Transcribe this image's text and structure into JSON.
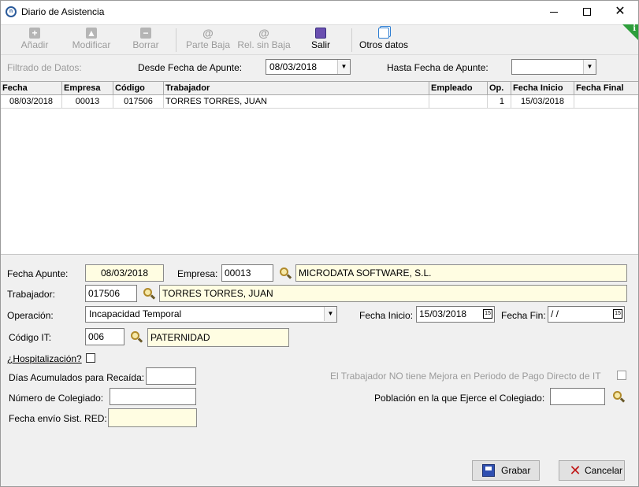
{
  "window": {
    "title": "Diario de Asistencia",
    "app_icon_letter": "n",
    "minimize_glyph": "",
    "close_glyph": "✕"
  },
  "toolbar": {
    "add_label": "Añadir",
    "modify_label": "Modificar",
    "delete_label": "Borrar",
    "parte_baja_label": "Parte Baja",
    "rel_sin_baja_label": "Rel. sin Baja",
    "exit_label": "Salir",
    "other_data_label": "Otros datos",
    "info_badge": "i"
  },
  "filter": {
    "title": "Filtrado de Datos:",
    "from_label": "Desde Fecha de Apunte:",
    "from_value": "08/03/2018",
    "to_label": "Hasta Fecha de Apunte:",
    "to_value": ""
  },
  "grid": {
    "columns": [
      "Fecha",
      "Empresa",
      "Código",
      "Trabajador",
      "Empleado",
      "Op.",
      "Fecha Inicio",
      "Fecha Final"
    ],
    "rows": [
      [
        "08/03/2018",
        "00013",
        "017506",
        "TORRES TORRES, JUAN",
        "",
        "1",
        "15/03/2018",
        ""
      ]
    ]
  },
  "form": {
    "fecha_apunte_label": "Fecha Apunte:",
    "fecha_apunte_value": "08/03/2018",
    "empresa_label": "Empresa:",
    "empresa_code": "00013",
    "empresa_name": "MICRODATA SOFTWARE, S.L.",
    "trabajador_label": "Trabajador:",
    "trabajador_code": "017506",
    "trabajador_name": "TORRES TORRES, JUAN",
    "operacion_label": "Operación:",
    "operacion_value": "Incapacidad Temporal",
    "fecha_inicio_label": "Fecha Inicio:",
    "fecha_inicio_value": "15/03/2018",
    "fecha_fin_label": "Fecha Fin:",
    "fecha_fin_value": " /  /",
    "codigo_it_label": "Código IT:",
    "codigo_it_code": "006",
    "codigo_it_name": "PATERNIDAD",
    "hospitalizacion_label": "¿Hospitalización?",
    "dias_label": "Días Acumulados para Recaída:",
    "dias_value": "",
    "mejora_label": "El Trabajador NO tiene Mejora en Periodo de Pago Directo de IT",
    "colegiado_label": "Número de Colegiado:",
    "colegiado_value": "",
    "poblacion_label": "Población en la que Ejerce el Colegiado:",
    "poblacion_value": "",
    "fecha_envio_label": "Fecha envío Sist. RED:",
    "fecha_envio_value": "",
    "calendar_glyph": "15"
  },
  "buttons": {
    "save_label": "Grabar",
    "cancel_label": "Cancelar",
    "cancel_glyph": "✕"
  },
  "colors": {
    "readonly_bg": "#fffde2",
    "corner_badge": "#2e9e3c"
  },
  "icons": [
    "plus-icon",
    "up-arrow-icon",
    "minus-icon",
    "at-icon",
    "exit-icon",
    "windows-icon",
    "search-icon",
    "calendar-icon",
    "save-icon",
    "cancel-icon"
  ]
}
